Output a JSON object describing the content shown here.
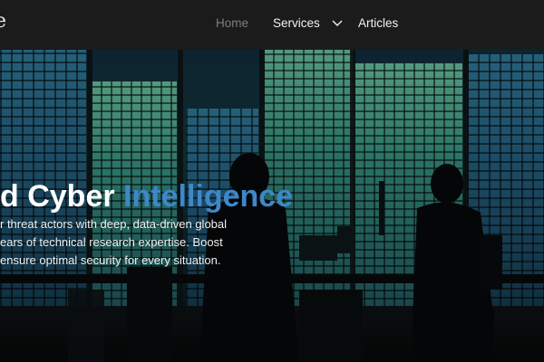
{
  "header": {
    "logo_text": "e",
    "nav": [
      {
        "label": "Home",
        "active": true
      },
      {
        "label": "Services",
        "has_dropdown": true
      },
      {
        "label": "Articles"
      }
    ]
  },
  "hero": {
    "title_part": "d Cyber",
    "title_accent": "Intelligence",
    "description_lines": [
      "r threat actors with deep, data-driven global",
      "ears of technical research expertise. Boost",
      "ensure optimal security for every situation."
    ]
  },
  "colors": {
    "header_bg": "#1b1b1b",
    "accent": "#3e87c9",
    "nav_active": "#7d7d7d"
  },
  "icons": {
    "services_dropdown": "chevron-down-icon"
  }
}
